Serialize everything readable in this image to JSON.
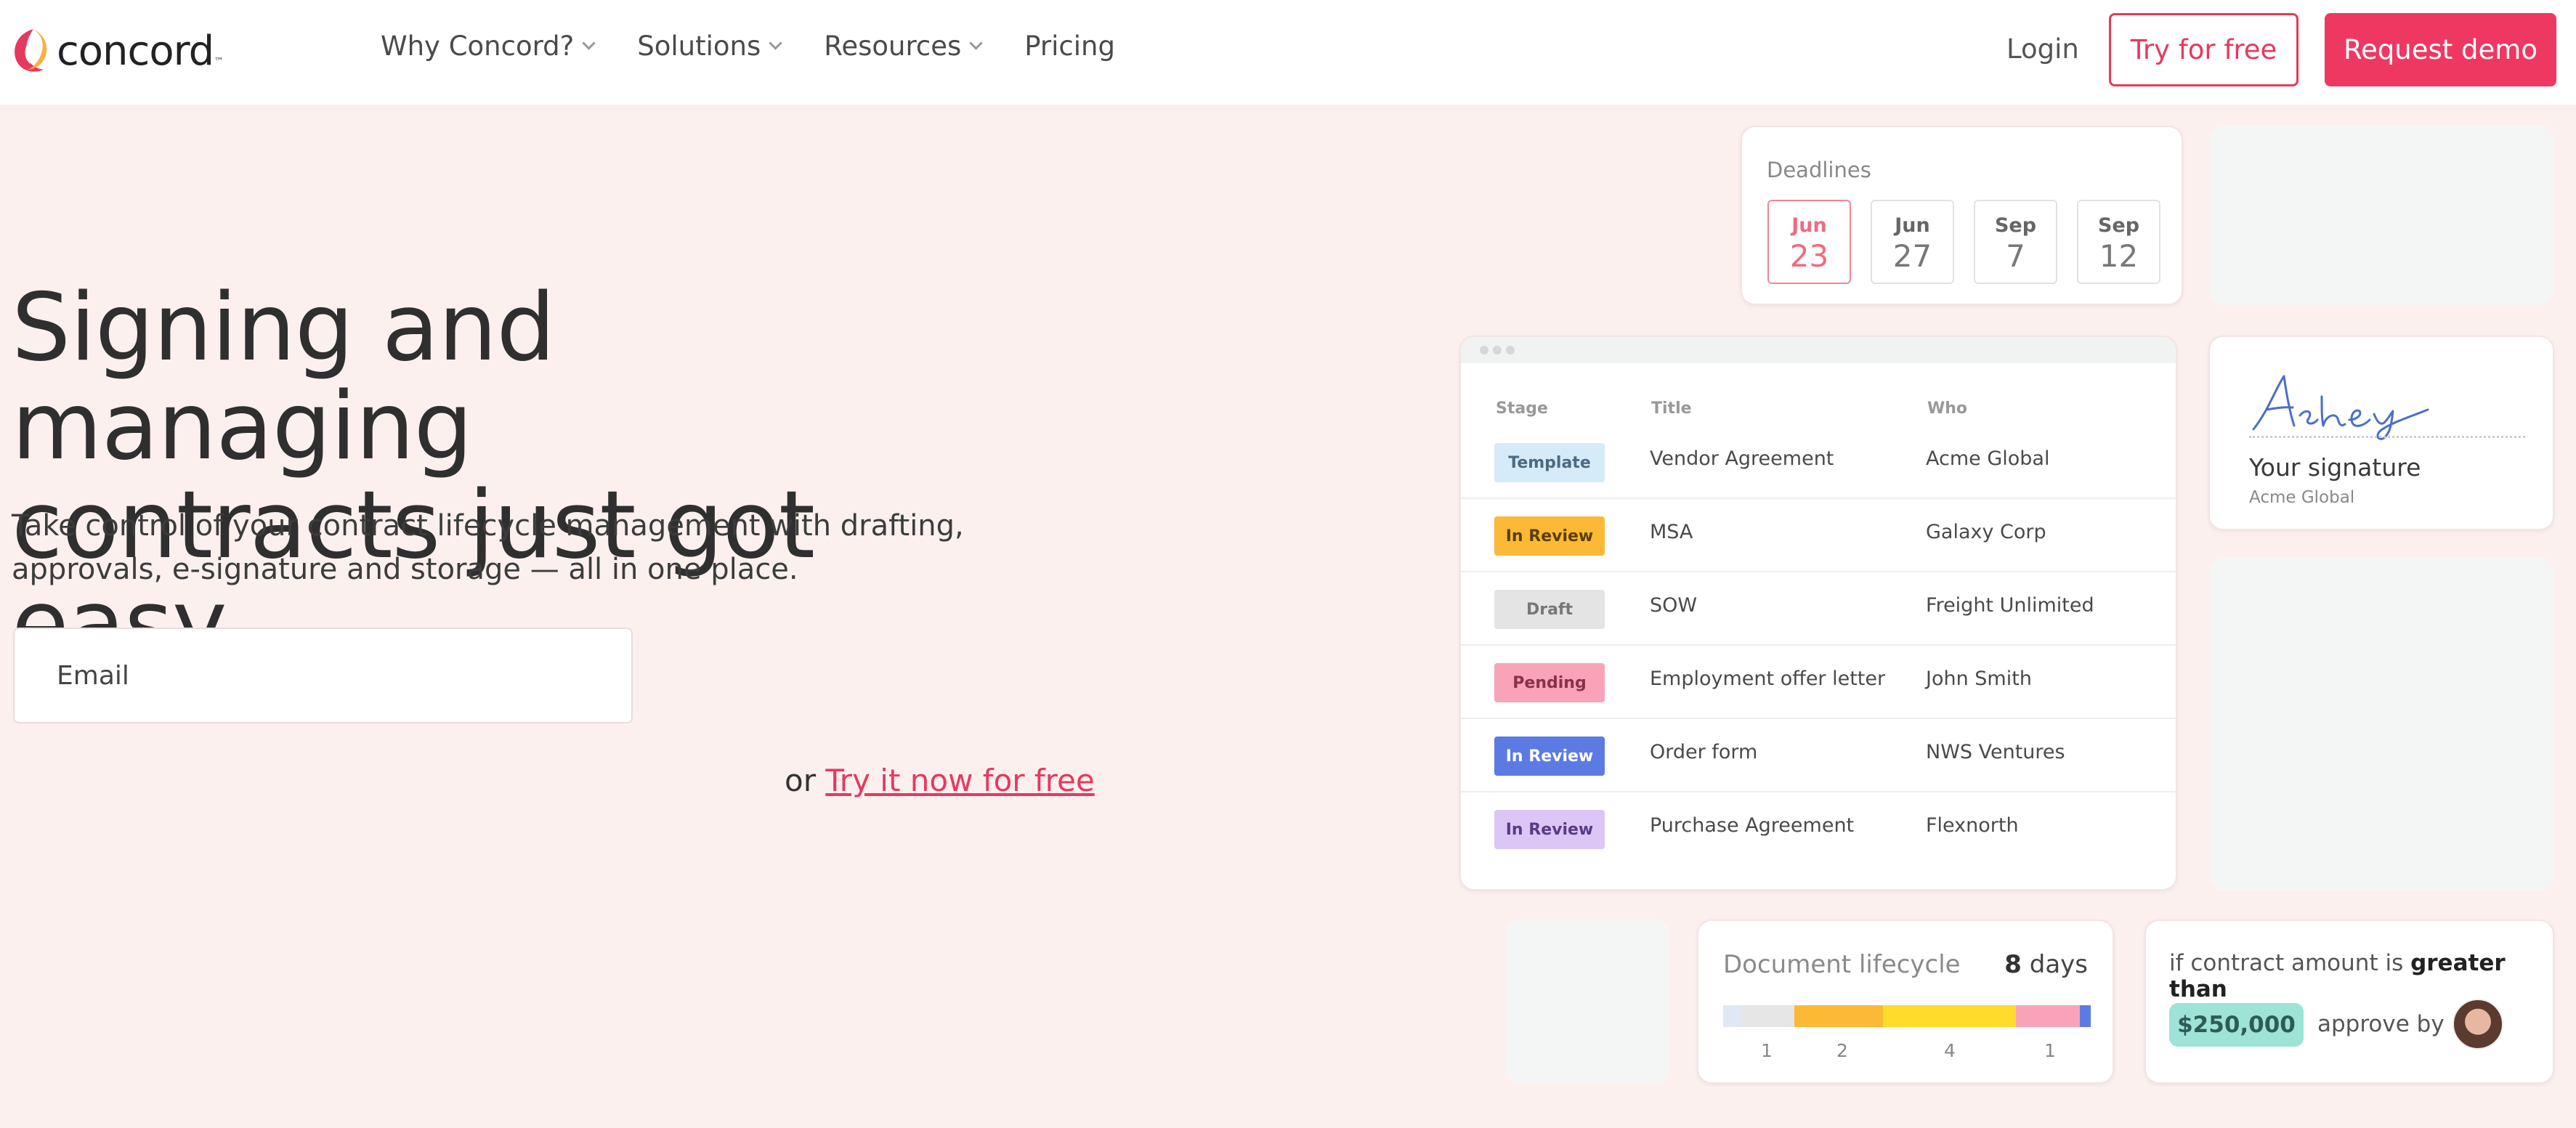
{
  "nav": {
    "brand": "concord",
    "brand_tm": "™",
    "items": [
      {
        "label": "Why Concord?",
        "has_dropdown": true
      },
      {
        "label": "Solutions",
        "has_dropdown": true
      },
      {
        "label": "Resources",
        "has_dropdown": true
      },
      {
        "label": "Pricing",
        "has_dropdown": false
      }
    ],
    "login": "Login",
    "try_free": "Try for free",
    "request_demo": "Request demo"
  },
  "hero": {
    "title_line1": "Signing and managing",
    "title_line2": "contracts just got easy",
    "subtitle_line1": "Take control of your contract lifecycle management with drafting,",
    "subtitle_line2": "approvals, e-signature and storage — all in one place.",
    "email_placeholder": "Email",
    "or_text": "or",
    "try_now": "Try it now for free"
  },
  "deadlines": {
    "title": "Deadlines",
    "dates": [
      {
        "month": "Jun",
        "day": "23",
        "active": true
      },
      {
        "month": "Jun",
        "day": "27",
        "active": false
      },
      {
        "month": "Sep",
        "day": "7",
        "active": false
      },
      {
        "month": "Sep",
        "day": "12",
        "active": false
      }
    ]
  },
  "contracts_table": {
    "columns": [
      "Stage",
      "Title",
      "Who"
    ],
    "rows": [
      {
        "stage": "Template",
        "title": "Vendor Agreement",
        "who": "Acme Global",
        "bg": "#d6ebf9",
        "fg": "#4b6a82"
      },
      {
        "stage": "In Review",
        "title": "MSA",
        "who": "Galaxy Corp",
        "bg": "#fbb935",
        "fg": "#5b3f0a"
      },
      {
        "stage": "Draft",
        "title": "SOW",
        "who": "Freight Unlimited",
        "bg": "#e4e4e4",
        "fg": "#777777"
      },
      {
        "stage": "Pending",
        "title": "Employment offer letter",
        "who": "John Smith",
        "bg": "#f9a3b9",
        "fg": "#8a3049"
      },
      {
        "stage": "In Review",
        "title": "Order form",
        "who": "NWS Ventures",
        "bg": "#5b7be3",
        "fg": "#ffffff"
      },
      {
        "stage": "In Review",
        "title": "Purchase Agreement",
        "who": "Flexnorth",
        "bg": "#dcc6f5",
        "fg": "#5a3a86"
      }
    ]
  },
  "signature": {
    "script": "Ashley",
    "label": "Your signature",
    "org": "Acme Global"
  },
  "lifecycle": {
    "title": "Document lifecycle",
    "days_value": "8",
    "days_unit": "days",
    "segments": [
      {
        "color": "#dfe9f5",
        "weight": 0.2
      },
      {
        "color": "#e6e6e6",
        "weight": 0.6
      },
      {
        "color": "#fbb935",
        "weight": 1.0
      },
      {
        "color": "#fddc2c",
        "weight": 1.5
      },
      {
        "color": "#f9a3b9",
        "weight": 0.72
      },
      {
        "color": "#5b7be3",
        "weight": 0.12
      }
    ],
    "labels": [
      "1",
      "2",
      "4",
      "1"
    ]
  },
  "approval": {
    "prefix": "if contract amount is",
    "emphasis": "greater than",
    "amount": "$250,000",
    "approve_by": "approve by"
  },
  "colors": {
    "accent": "#ee3862",
    "background": "#fcf0ef"
  }
}
